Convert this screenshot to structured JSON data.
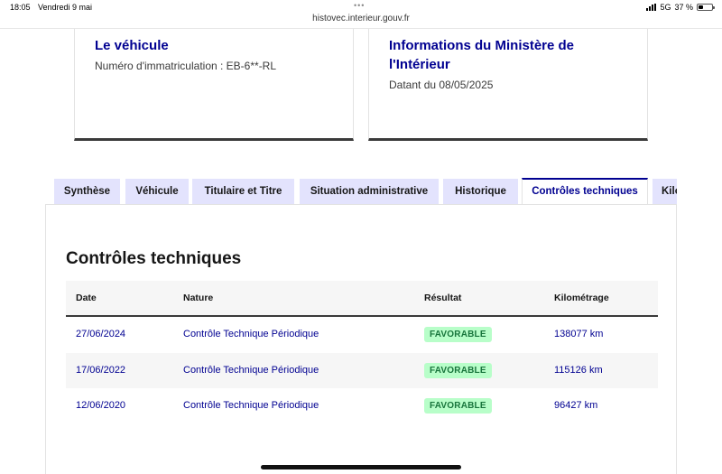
{
  "status_bar": {
    "time": "18:05",
    "date": "Vendredi 9 mai",
    "network": "5G",
    "battery": "37 %"
  },
  "url": "histovec.interieur.gouv.fr",
  "cards": {
    "vehicle": {
      "title": "Le véhicule",
      "text": "Numéro d'immatriculation : EB-6**-RL"
    },
    "ministry": {
      "title": "Informations du Ministère de l'Intérieur",
      "text": "Datant du 08/05/2025"
    }
  },
  "tabs": [
    {
      "label": "Synthèse"
    },
    {
      "label": "Véhicule"
    },
    {
      "label": "Titulaire et Titre"
    },
    {
      "label": "Situation administrative"
    },
    {
      "label": "Historique"
    },
    {
      "label": "Contrôles techniques"
    },
    {
      "label": "Kilométrage"
    }
  ],
  "panel": {
    "title": "Contrôles techniques",
    "columns": [
      "Date",
      "Nature",
      "Résultat",
      "Kilométrage"
    ],
    "rows": [
      {
        "date": "27/06/2024",
        "nature": "Contrôle Technique Périodique",
        "result": "FAVORABLE",
        "km": "138077 km"
      },
      {
        "date": "17/06/2022",
        "nature": "Contrôle Technique Périodique",
        "result": "FAVORABLE",
        "km": "115126 km"
      },
      {
        "date": "12/06/2020",
        "nature": "Contrôle Technique Périodique",
        "result": "FAVORABLE",
        "km": "96427 km"
      }
    ]
  },
  "colors": {
    "primary": "#000091",
    "tab_background": "#e3e3fd",
    "success_bg": "#b8fec9",
    "success_text": "#18753c"
  },
  "icons": [
    "signal-icon",
    "battery-icon",
    "multitask-dots-icon"
  ]
}
